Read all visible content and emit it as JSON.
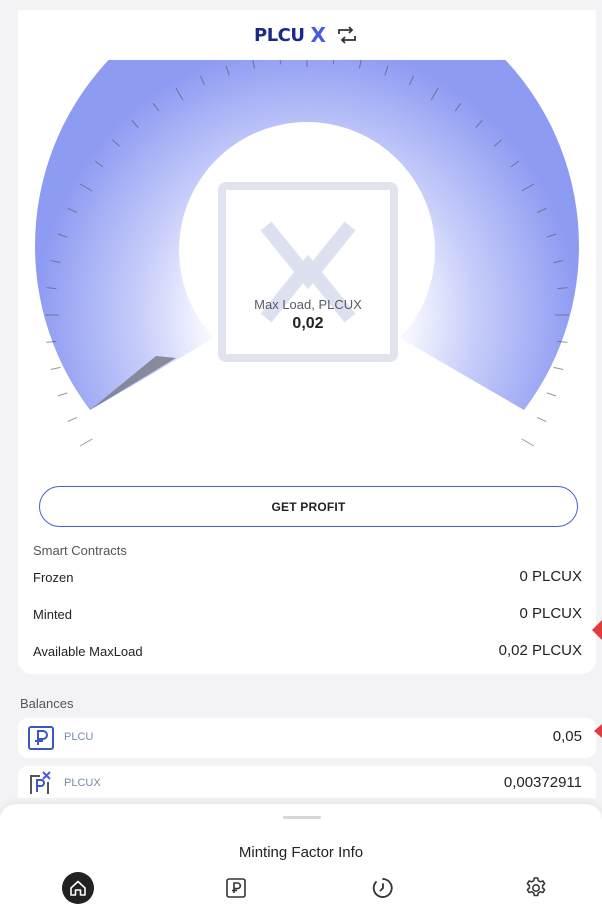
{
  "header": {
    "logo_text": "PLCU",
    "logo_x": "X",
    "swap_icon": "swap-arrows-icon"
  },
  "gauge": {
    "label": "Max Load, PLCUX",
    "value": "0,02",
    "level_fraction": 0.0
  },
  "actions": {
    "get_profit": "GET PROFIT"
  },
  "smart_contracts": {
    "title": "Smart Contracts",
    "rows": [
      {
        "label": "Frozen",
        "value": "0 PLCUX"
      },
      {
        "label": "Minted",
        "value": "0 PLCUX"
      },
      {
        "label": "Available MaxLoad",
        "value": "0,02 PLCUX"
      }
    ]
  },
  "balances": {
    "title": "Balances",
    "items": [
      {
        "name": "PLCU",
        "value": "0,05",
        "icon": "plcu-coin-icon"
      },
      {
        "name": "PLCUX",
        "value": "0,00372911",
        "icon": "plcux-coin-icon"
      }
    ]
  },
  "sheet": {
    "title": "Minting Factor Info"
  },
  "nav": [
    {
      "name": "home",
      "icon": "home-icon",
      "active": true
    },
    {
      "name": "wallet",
      "icon": "plcu-card-icon",
      "active": false
    },
    {
      "name": "history",
      "icon": "history-icon",
      "active": false
    },
    {
      "name": "settings",
      "icon": "gear-icon",
      "active": false
    }
  ],
  "colors": {
    "accent": "#4b5fd8",
    "gauge": "#8e9bf2",
    "brand": "#1a2a8a"
  }
}
